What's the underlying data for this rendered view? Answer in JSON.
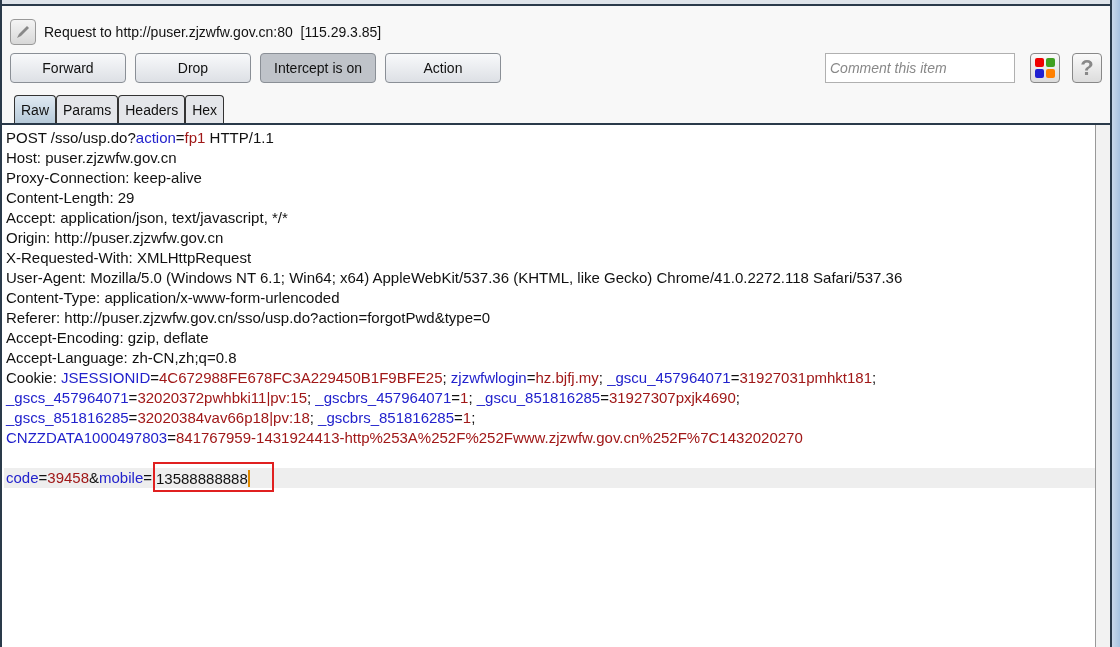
{
  "request_title": "Request to http://puser.zjzwfw.gov.cn:80  [115.29.3.85]",
  "buttons": [
    {
      "label": "Forward",
      "pressed": false
    },
    {
      "label": "Drop",
      "pressed": false
    },
    {
      "label": "Intercept is on",
      "pressed": true
    },
    {
      "label": "Action",
      "pressed": false
    }
  ],
  "comment": {
    "placeholder": "Comment this item"
  },
  "help_button": {
    "label": "?"
  },
  "tabs": [
    {
      "label": "Raw",
      "selected": true
    },
    {
      "label": "Params",
      "selected": false
    },
    {
      "label": "Headers",
      "selected": false
    },
    {
      "label": "Hex",
      "selected": false
    }
  ],
  "lines": [
    {
      "current": false,
      "segments": [
        {
          "kind": "text",
          "text": "POST /sso/usp.do?"
        },
        {
          "kind": "name",
          "text": "action"
        },
        {
          "kind": "text",
          "text": "="
        },
        {
          "kind": "value",
          "text": "fp1"
        },
        {
          "kind": "text",
          "text": " HTTP/1.1"
        }
      ]
    },
    {
      "current": false,
      "segments": [
        {
          "kind": "text",
          "text": "Host: puser.zjzwfw.gov.cn"
        }
      ]
    },
    {
      "current": false,
      "segments": [
        {
          "kind": "text",
          "text": "Proxy-Connection: keep-alive"
        }
      ]
    },
    {
      "current": false,
      "segments": [
        {
          "kind": "text",
          "text": "Content-Length: 29"
        }
      ]
    },
    {
      "current": false,
      "segments": [
        {
          "kind": "text",
          "text": "Accept: application/json, text/javascript, */*"
        }
      ]
    },
    {
      "current": false,
      "segments": [
        {
          "kind": "text",
          "text": "Origin: http://puser.zjzwfw.gov.cn"
        }
      ]
    },
    {
      "current": false,
      "segments": [
        {
          "kind": "text",
          "text": "X-Requested-With: XMLHttpRequest"
        }
      ]
    },
    {
      "current": false,
      "segments": [
        {
          "kind": "text",
          "text": "User-Agent: Mozilla/5.0 (Windows NT 6.1; Win64; x64) AppleWebKit/537.36 (KHTML, like Gecko) Chrome/41.0.2272.118 Safari/537.36"
        }
      ]
    },
    {
      "current": false,
      "segments": [
        {
          "kind": "text",
          "text": "Content-Type: application/x-www-form-urlencoded"
        }
      ]
    },
    {
      "current": false,
      "segments": [
        {
          "kind": "text",
          "text": "Referer: http://puser.zjzwfw.gov.cn/sso/usp.do?action=forgotPwd&type=0"
        }
      ]
    },
    {
      "current": false,
      "segments": [
        {
          "kind": "text",
          "text": "Accept-Encoding: gzip, deflate"
        }
      ]
    },
    {
      "current": false,
      "segments": [
        {
          "kind": "text",
          "text": "Accept-Language: zh-CN,zh;q=0.8"
        }
      ]
    },
    {
      "current": false,
      "segments": [
        {
          "kind": "text",
          "text": "Cookie: "
        },
        {
          "kind": "name",
          "text": "JSESSIONID"
        },
        {
          "kind": "text",
          "text": "="
        },
        {
          "kind": "value",
          "text": "4C672988FE678FC3A229450B1F9BFE25"
        },
        {
          "kind": "text",
          "text": "; "
        },
        {
          "kind": "name",
          "text": "zjzwfwlogin"
        },
        {
          "kind": "text",
          "text": "="
        },
        {
          "kind": "value",
          "text": "hz.bjfj.my"
        },
        {
          "kind": "text",
          "text": "; "
        },
        {
          "kind": "name",
          "text": "_gscu_457964071"
        },
        {
          "kind": "text",
          "text": "="
        },
        {
          "kind": "value",
          "text": "31927031pmhkt181"
        },
        {
          "kind": "text",
          "text": ";"
        }
      ]
    },
    {
      "current": false,
      "segments": [
        {
          "kind": "name",
          "text": "_gscs_457964071"
        },
        {
          "kind": "text",
          "text": "="
        },
        {
          "kind": "value",
          "text": "32020372pwhbki11|pv:15"
        },
        {
          "kind": "text",
          "text": "; "
        },
        {
          "kind": "name",
          "text": "_gscbrs_457964071"
        },
        {
          "kind": "text",
          "text": "="
        },
        {
          "kind": "value",
          "text": "1"
        },
        {
          "kind": "text",
          "text": "; "
        },
        {
          "kind": "name",
          "text": "_gscu_851816285"
        },
        {
          "kind": "text",
          "text": "="
        },
        {
          "kind": "value",
          "text": "31927307pxjk4690"
        },
        {
          "kind": "text",
          "text": ";"
        }
      ]
    },
    {
      "current": false,
      "segments": [
        {
          "kind": "name",
          "text": "_gscs_851816285"
        },
        {
          "kind": "text",
          "text": "="
        },
        {
          "kind": "value",
          "text": "32020384vav66p18|pv:18"
        },
        {
          "kind": "text",
          "text": "; "
        },
        {
          "kind": "name",
          "text": "_gscbrs_851816285"
        },
        {
          "kind": "text",
          "text": "="
        },
        {
          "kind": "value",
          "text": "1"
        },
        {
          "kind": "text",
          "text": ";"
        }
      ]
    },
    {
      "current": false,
      "segments": [
        {
          "kind": "name",
          "text": "CNZZDATA1000497803"
        },
        {
          "kind": "text",
          "text": "="
        },
        {
          "kind": "value",
          "text": "841767959-1431924413-http%253A%252F%252Fwww.zjzwfw.gov.cn%252F%7C1432020270"
        }
      ]
    },
    {
      "current": false
    },
    {
      "current": true,
      "segments": [
        {
          "kind": "name",
          "text": "code"
        },
        {
          "kind": "text",
          "text": "="
        },
        {
          "kind": "value",
          "text": "39458"
        },
        {
          "kind": "text",
          "text": "&"
        },
        {
          "kind": "name",
          "text": "mobile"
        },
        {
          "kind": "text",
          "text": "="
        },
        {
          "kind": "text",
          "text": "13588888888",
          "marked": true
        }
      ]
    }
  ]
}
